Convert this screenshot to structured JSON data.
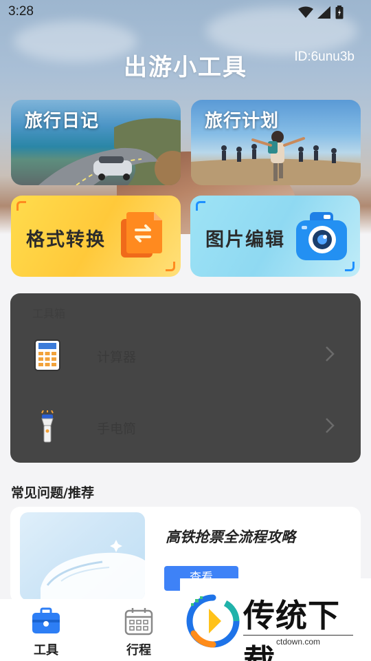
{
  "status_bar": {
    "time": "3:28",
    "icons": [
      "wifi-icon",
      "signal-icon",
      "battery-icon"
    ]
  },
  "header": {
    "title": "出游小工具",
    "user_id": "ID:6unu3b"
  },
  "photo_cards": [
    {
      "label": "旅行日记",
      "image": "coastal-road-car-photo"
    },
    {
      "label": "旅行计划",
      "image": "friends-running-beach-photo"
    }
  ],
  "feature_cards": [
    {
      "label": "格式转换",
      "icon": "file-convert-icon",
      "accent": "#ff8a1f"
    },
    {
      "label": "图片编辑",
      "icon": "camera-icon",
      "accent": "#1e90ff"
    }
  ],
  "toolbox": {
    "title": "工具箱",
    "items": [
      {
        "label": "计算器",
        "icon": "calculator-icon"
      },
      {
        "label": "手电筒",
        "icon": "flashlight-icon"
      }
    ]
  },
  "recommend": {
    "section_title": "常见问题/推荐",
    "card_title": "高铁抢票全流程攻略",
    "button_label": "查看",
    "image": "bullet-train-illustration"
  },
  "tabbar": {
    "tabs": [
      {
        "label": "工具",
        "icon": "toolbox-icon",
        "active": true
      },
      {
        "label": "行程",
        "icon": "calendar-icon",
        "active": false
      }
    ]
  },
  "watermark": {
    "brand": "传统下载",
    "url": "ctdown.com"
  },
  "colors": {
    "primary": "#3e82f7",
    "toolbox_bg": "#454545",
    "format_card": "#ffd23f",
    "image_card": "#9ee3f5"
  }
}
